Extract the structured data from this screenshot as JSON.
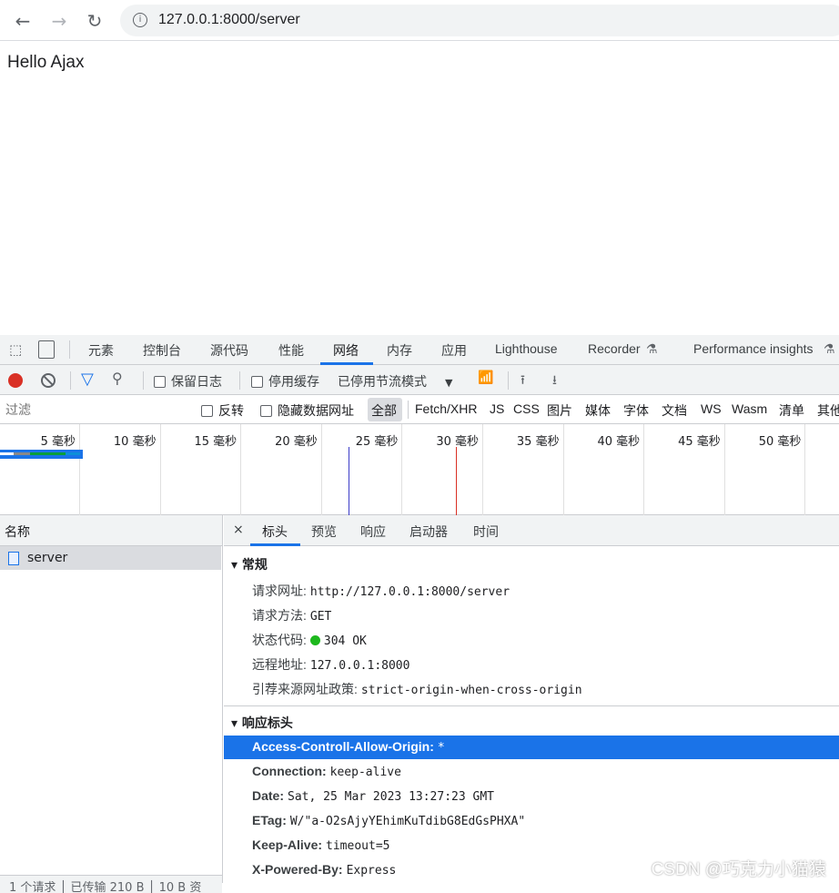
{
  "browser": {
    "url": "127.0.0.1:8000/server"
  },
  "page": {
    "text": "Hello Ajax"
  },
  "devtools": {
    "tabs": [
      "元素",
      "控制台",
      "源代码",
      "性能",
      "网络",
      "内存",
      "应用",
      "Lighthouse",
      "Recorder",
      "Performance insights"
    ],
    "active_tab": "网络",
    "toolbar": {
      "preserve_log": "保留日志",
      "disable_cache": "停用缓存",
      "throttle": "已停用节流模式"
    },
    "filter": {
      "placeholder": "过滤",
      "invert": "反转",
      "hide_data_urls": "隐藏数据网址",
      "types": [
        "全部",
        "Fetch/XHR",
        "JS",
        "CSS",
        "图片",
        "媒体",
        "字体",
        "文档",
        "WS",
        "Wasm",
        "清单",
        "其他"
      ]
    },
    "timeline": {
      "ticks": [
        "5 毫秒",
        "10 毫秒",
        "15 毫秒",
        "20 毫秒",
        "25 毫秒",
        "30 毫秒",
        "35 毫秒",
        "40 毫秒",
        "45 毫秒",
        "50 毫秒"
      ]
    },
    "requests": {
      "header": "名称",
      "items": [
        "server"
      ],
      "status": [
        "1 个请求",
        "已传输 210 B",
        "10 B 资"
      ]
    },
    "details": {
      "tabs": [
        "标头",
        "预览",
        "响应",
        "启动器",
        "时间"
      ],
      "close": "×",
      "general": {
        "title": "常规",
        "rows": [
          {
            "k": "请求网址:",
            "v": "http://127.0.0.1:8000/server"
          },
          {
            "k": "请求方法:",
            "v": "GET"
          },
          {
            "k": "状态代码:",
            "v": "304 OK"
          },
          {
            "k": "远程地址:",
            "v": "127.0.0.1:8000"
          },
          {
            "k": "引荐来源网址政策:",
            "v": "strict-origin-when-cross-origin"
          }
        ]
      },
      "response": {
        "title": "响应标头",
        "rows": [
          {
            "k": "Access-Controll-Allow-Origin:",
            "v": "*"
          },
          {
            "k": "Connection:",
            "v": "keep-alive"
          },
          {
            "k": "Date:",
            "v": "Sat, 25 Mar 2023 13:27:23 GMT"
          },
          {
            "k": "ETag:",
            "v": "W/\"a-O2sAjyYEhimKuTdibG8EdGsPHXA\""
          },
          {
            "k": "Keep-Alive:",
            "v": "timeout=5"
          },
          {
            "k": "X-Powered-By:",
            "v": "Express"
          }
        ]
      }
    }
  },
  "watermark": "CSDN @巧克力小猫猿"
}
